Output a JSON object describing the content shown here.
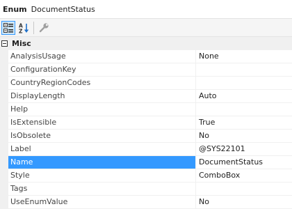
{
  "header": {
    "type_label": "Enum",
    "object_name": "DocumentStatus"
  },
  "toolbar": {
    "buttons": [
      {
        "icon": "categorized-icon",
        "active": true
      },
      {
        "icon": "alphabetical-sort-icon",
        "active": false
      },
      {
        "icon": "property-pages-icon",
        "active": false
      }
    ]
  },
  "grid": {
    "category": {
      "label": "Misc",
      "expanded": true
    },
    "properties": [
      {
        "name": "AnalysisUsage",
        "value": "None"
      },
      {
        "name": "ConfigurationKey",
        "value": ""
      },
      {
        "name": "CountryRegionCodes",
        "value": ""
      },
      {
        "name": "DisplayLength",
        "value": "Auto"
      },
      {
        "name": "Help",
        "value": ""
      },
      {
        "name": "IsExtensible",
        "value": "True"
      },
      {
        "name": "IsObsolete",
        "value": "No"
      },
      {
        "name": "Label",
        "value": "@SYS22101"
      },
      {
        "name": "Name",
        "value": "DocumentStatus",
        "selected": true
      },
      {
        "name": "Style",
        "value": "ComboBox"
      },
      {
        "name": "Tags",
        "value": ""
      },
      {
        "name": "UseEnumValue",
        "value": "No"
      }
    ]
  },
  "colors": {
    "selection": "#3399ff",
    "grid_line": "#f0f0f0",
    "toolbar_active": "#cde6f7"
  }
}
